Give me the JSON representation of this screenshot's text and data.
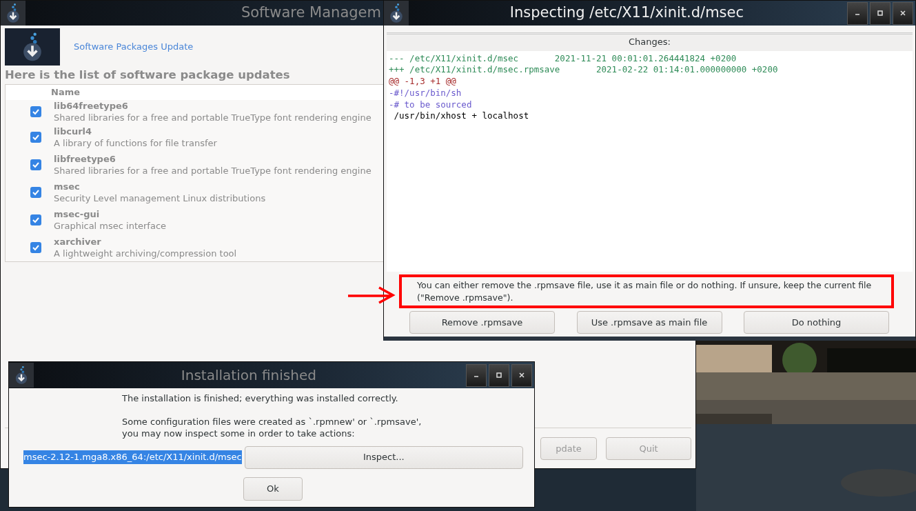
{
  "main_window": {
    "title": "Software Managem",
    "header_link": "Software Packages Update",
    "heading": "Here is the list of software package updates",
    "table": {
      "columns": [
        "Name"
      ],
      "rows": [
        {
          "name": "lib64freetype6",
          "description": "Shared libraries for a free and portable TrueType font rendering engine",
          "checked": true
        },
        {
          "name": "libcurl4",
          "description": "A library of functions for file transfer",
          "checked": true
        },
        {
          "name": "libfreetype6",
          "description": "Shared libraries for a free and portable TrueType font rendering engine",
          "checked": true
        },
        {
          "name": "msec",
          "description": "Security Level management Linux distributions",
          "checked": true
        },
        {
          "name": "msec-gui",
          "description": "Graphical msec interface",
          "checked": true
        },
        {
          "name": "xarchiver",
          "description": "A lightweight archiving/compression tool",
          "checked": true
        }
      ]
    },
    "buttons": [
      {
        "label": "pdate",
        "disabled": true
      },
      {
        "label": "Quit",
        "disabled": true
      }
    ]
  },
  "inspect_window": {
    "title": "Inspecting /etc/X11/xinit.d/msec",
    "changes_label": "Changes:",
    "diff": [
      {
        "kind": "header",
        "text": "--- /etc/X11/xinit.d/msec\t2021-11-21 00:01:01.264441824 +0200"
      },
      {
        "kind": "header",
        "text": "+++ /etc/X11/xinit.d/msec.rpmsave\t2021-02-22 01:14:01.000000000 +0200"
      },
      {
        "kind": "hunk",
        "text": "@@ -1,3 +1 @@"
      },
      {
        "kind": "removed",
        "text": "-#!/usr/bin/sh"
      },
      {
        "kind": "removed",
        "text": "-# to be sourced"
      },
      {
        "kind": "context",
        "text": " /usr/bin/xhost + localhost"
      }
    ],
    "message": "You can either remove the .rpmsave file, use it as main file or do nothing. If unsure, keep the current file (\"Remove .rpmsave\").",
    "buttons": [
      "Remove .rpmsave",
      "Use .rpmsave as main file",
      "Do nothing"
    ]
  },
  "annotation": {
    "frame": true,
    "arrow": true
  },
  "install_dialog": {
    "title": "Installation finished",
    "line_1": "The installation is finished; everything was installed correctly.",
    "line_2": "Some configuration files were created as `.rpmnew' or `.rpmsave',\nyou may now inspect some in order to take actions:",
    "file": {
      "text": "msec-2.12-1.mga8.x86_64:/etc/X11/xinit.d/msec",
      "selected": true
    },
    "inspect_button": "Inspect...",
    "ok_button": "Ok"
  }
}
